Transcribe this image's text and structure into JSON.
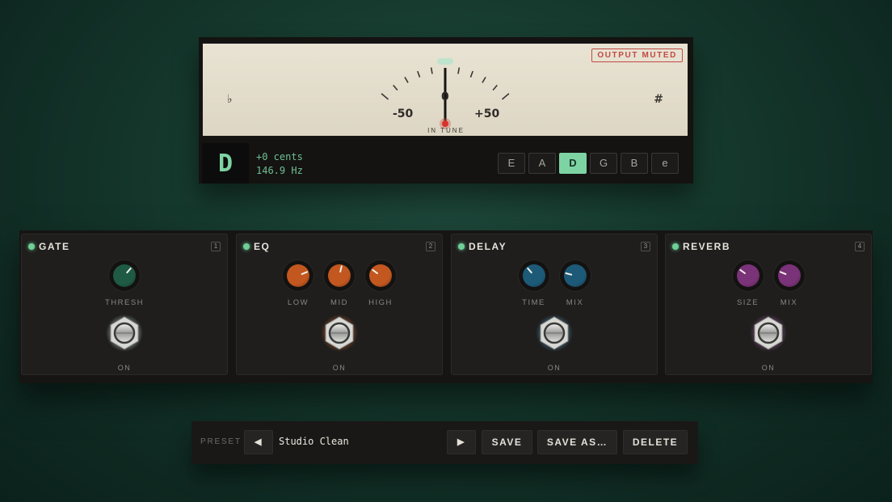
{
  "tuner": {
    "status_badge": "OUTPUT MUTED",
    "flat_symbol": "♭",
    "sharp_symbol": "#",
    "scale_left": "-50",
    "scale_center": "0",
    "scale_right": "+50",
    "in_tune_label": "IN TUNE",
    "needle_cents": 0,
    "note": "D",
    "cents_readout": "+0 cents",
    "freq_readout": "146.9 Hz",
    "strings": [
      "E",
      "A",
      "D",
      "G",
      "B",
      "e"
    ],
    "active_string": "D",
    "accent_color": "#7ed3a3",
    "alert_color": "#c24a44"
  },
  "pedals": [
    {
      "name": "GATE",
      "number": "1",
      "knobs": [
        {
          "label": "THRESH",
          "value": 0.65
        }
      ],
      "state": "ON",
      "color": "#1f5a44",
      "glow": "#cfe9dc"
    },
    {
      "name": "EQ",
      "number": "2",
      "knobs": [
        {
          "label": "LOW",
          "value": 0.75
        },
        {
          "label": "MID",
          "value": 0.55
        },
        {
          "label": "HIGH",
          "value": 0.3
        }
      ],
      "state": "ON",
      "color": "#c2571f",
      "glow": "#e0672a"
    },
    {
      "name": "DELAY",
      "number": "3",
      "knobs": [
        {
          "label": "TIME",
          "value": 0.35
        },
        {
          "label": "MIX",
          "value": 0.22
        }
      ],
      "state": "ON",
      "color": "#1d5a78",
      "glow": "#5aa8d8"
    },
    {
      "name": "REVERB",
      "number": "4",
      "knobs": [
        {
          "label": "SIZE",
          "value": 0.3
        },
        {
          "label": "MIX",
          "value": 0.25
        }
      ],
      "state": "ON",
      "color": "#7a3278",
      "glow": "#b36ab6"
    }
  ],
  "preset": {
    "label": "PRESET",
    "prev_icon": "◀",
    "name": "Studio Clean",
    "next_icon": "▶",
    "save": "SAVE",
    "save_as": "SAVE AS…",
    "delete": "DELETE"
  }
}
